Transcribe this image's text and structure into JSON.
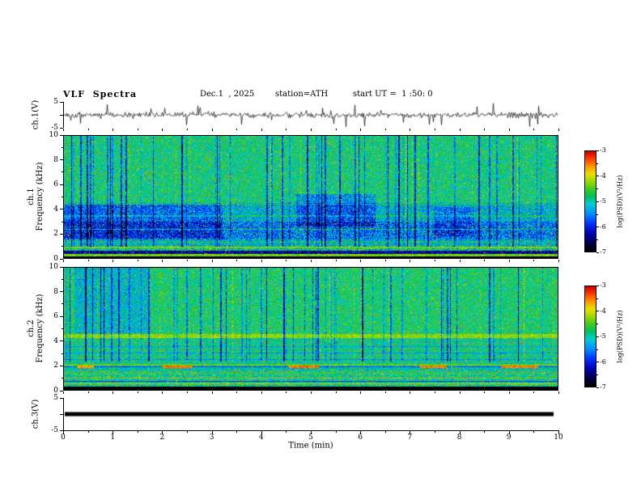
{
  "figure": {
    "title": "VLF  Spectra",
    "date": "Dec.1  , 2025",
    "station": "station=ATH",
    "start_ut": "start UT =  1 :50: 0"
  },
  "axes": {
    "time": {
      "label": "Time (min)",
      "min": 0,
      "max": 10,
      "tick_labels": [
        "0",
        "1",
        "2",
        "3",
        "4",
        "5",
        "6",
        "7",
        "8",
        "9",
        "10"
      ]
    },
    "freq": {
      "min": 0,
      "max": 10,
      "major_tick_labels": [
        "0",
        "2",
        "4",
        "6",
        "8",
        "10"
      ]
    },
    "volt": {
      "max_label": "5",
      "min_label": "-5"
    }
  },
  "panels": {
    "ch1_wave": {
      "ylabel": "ch.1(V)"
    },
    "ch1_spec": {
      "ylabel_line1": "ch.1",
      "ylabel_line2": "Frequency (kHz)"
    },
    "ch2_spec": {
      "ylabel_line1": "ch.2",
      "ylabel_line2": "Frequency (kHz)"
    },
    "ch3_wave": {
      "ylabel": "ch.3(V)"
    }
  },
  "colorbar": {
    "label": "log(PSD)(V²/Hz)",
    "tick_labels": [
      "-3",
      "-4",
      "-5",
      "-6",
      "-7"
    ],
    "zmax": -3,
    "zmin": -7
  },
  "colormap": [
    [
      -7,
      "#000000"
    ],
    [
      -6.7,
      "#000040"
    ],
    [
      -6.3,
      "#0000b0"
    ],
    [
      -5.9,
      "#0030ff"
    ],
    [
      -5.5,
      "#0090ff"
    ],
    [
      -5.1,
      "#00d0d0"
    ],
    [
      -4.8,
      "#00c060"
    ],
    [
      -4.5,
      "#40cc20"
    ],
    [
      -4.2,
      "#a0d800"
    ],
    [
      -3.9,
      "#e8e000"
    ],
    [
      -3.6,
      "#ff9800"
    ],
    [
      -3.3,
      "#ff4000"
    ],
    [
      -3,
      "#cc0000"
    ]
  ],
  "chart_data": [
    {
      "target": "wave1-canvas",
      "type": "line",
      "name": "ch.1 voltage waveform",
      "xlim": [
        0,
        10
      ],
      "ylim": [
        -5,
        5
      ],
      "xlabel": "Time (min)",
      "ylabel": "ch.1(V)",
      "seed": 1337,
      "noise_amp": 1.0,
      "spike_prob": 0.06,
      "spike_amp": 3.8,
      "description": "Continuous noisy trace centred on 0 V (~±1 V band) with frequent impulsive spikes reaching about ±5 V throughout the 10-minute record."
    },
    {
      "target": "spec1-canvas",
      "type": "heatmap",
      "name": "ch.1 spectrogram",
      "xlim": [
        0,
        10
      ],
      "ylim": [
        0,
        10
      ],
      "zlim": [
        -7,
        -3
      ],
      "xlabel": "Time (min)",
      "ylabel": "ch.1 Frequency (kHz)",
      "zlabel": "log(PSD)(V²/Hz)",
      "seed": 42,
      "bands": [
        {
          "f0": 4.5,
          "f1": 10.01,
          "level": -4.85,
          "noise": 0.55
        },
        {
          "f0": 3.0,
          "f1": 4.5,
          "level": -5.2,
          "noise": 0.6
        },
        {
          "f0": 1.5,
          "f1": 3.0,
          "level": -5.55,
          "noise": 0.7
        },
        {
          "f0": 1.0,
          "f1": 1.5,
          "level": -5.2,
          "noise": 0.6
        },
        {
          "f0": 0.6,
          "f1": 1.0,
          "level": -5.0,
          "noise": 0.9
        },
        {
          "f0": 0.3,
          "f1": 0.6,
          "level": -6.4,
          "noise": 0.7
        },
        {
          "f0": 0.13,
          "f1": 0.3,
          "level": -4.3,
          "noise": 0.4
        },
        {
          "f0": 0.0,
          "f1": 0.13,
          "level": -7,
          "noise": 0.05
        }
      ],
      "hlines": [
        {
          "f": 2.35,
          "w": 0.1,
          "level": -4.7
        },
        {
          "f": 3.45,
          "w": 0.1,
          "level": -4.8
        },
        {
          "f": 0.85,
          "w": 0.12,
          "level": -4.35
        },
        {
          "f": 1.3,
          "w": 0.1,
          "level": -4.6
        },
        {
          "f": 4.4,
          "w": 0.1,
          "level": -4.6
        }
      ],
      "patches": [
        {
          "t0": 0.0,
          "t1": 3.2,
          "f0": 1.6,
          "f1": 4.4,
          "dl": -0.45
        },
        {
          "t0": 4.7,
          "t1": 6.3,
          "f0": 2.6,
          "f1": 5.2,
          "dl": -0.55
        },
        {
          "t0": 7.5,
          "t1": 8.3,
          "f0": 1.8,
          "f1": 4.2,
          "dl": -0.4
        }
      ],
      "streak_prob": 0.13,
      "streak_min": 0.45,
      "streak_var": 1.15,
      "streak_fmin": 0.95,
      "bright_prob": 0.03,
      "speckle_prob": 0.02,
      "speckle_level": -3.6,
      "description": "Speckled green/cyan broadband background (~1e-5 V²/Hz) above ~4.5 kHz with many narrow dark-blue vertical dropout streaks; bluer suppressed band 1.5–4.5 kHz; bright narrow lines near 0.85, 1.3, 2.35, 3.45 and 4.4 kHz; dark band 0.3–0.6 kHz and black band below ~0.15 kHz; sparse orange/red speckles."
    },
    {
      "target": "spec2-canvas",
      "type": "heatmap",
      "name": "ch.2 spectrogram",
      "xlim": [
        0,
        10
      ],
      "ylim": [
        0,
        10
      ],
      "zlim": [
        -7,
        -3
      ],
      "xlabel": "Time (min)",
      "ylabel": "ch.2 Frequency (kHz)",
      "zlabel": "log(PSD)(V²/Hz)",
      "seed": 99,
      "bands": [
        {
          "f0": 4.6,
          "f1": 10.01,
          "level": -4.8,
          "noise": 0.5
        },
        {
          "f0": 4.25,
          "f1": 4.6,
          "level": -4.25,
          "noise": 0.3
        },
        {
          "f0": 2.2,
          "f1": 4.25,
          "level": -4.9,
          "noise": 0.55
        },
        {
          "f0": 1.6,
          "f1": 2.2,
          "level": -5.05,
          "noise": 0.6
        },
        {
          "f0": 0.25,
          "f1": 1.6,
          "level": -4.9,
          "noise": 0.7
        },
        {
          "f0": 0.0,
          "f1": 0.25,
          "level": -7,
          "noise": 0.05
        }
      ],
      "hlines": [
        {
          "f": 0.5,
          "w": 0.12,
          "level": -4.2
        },
        {
          "f": 0.72,
          "w": 0.07,
          "level": -5.9
        },
        {
          "f": 0.95,
          "w": 0.1,
          "level": -4.4
        },
        {
          "f": 1.35,
          "w": 0.09,
          "level": -4.5
        },
        {
          "f": 1.9,
          "w": 0.09,
          "level": -5.8
        },
        {
          "f": 2.05,
          "w": 0.09,
          "level": -4.4
        },
        {
          "f": 2.5,
          "w": 0.07,
          "level": -5.5
        },
        {
          "f": 3.0,
          "w": 0.07,
          "level": -5.45
        },
        {
          "f": 3.55,
          "w": 0.07,
          "level": -5.4
        }
      ],
      "dashes": [
        {
          "t0": 2.0,
          "t1": 2.6,
          "f0": 1.76,
          "f1": 1.98,
          "level": -3.45
        },
        {
          "t0": 4.55,
          "t1": 5.15,
          "f0": 1.76,
          "f1": 1.98,
          "level": -3.45
        },
        {
          "t0": 7.2,
          "t1": 7.75,
          "f0": 1.76,
          "f1": 1.98,
          "level": -3.5
        },
        {
          "t0": 8.85,
          "t1": 9.6,
          "f0": 1.76,
          "f1": 1.98,
          "level": -3.5
        },
        {
          "t0": 0.25,
          "t1": 0.6,
          "f0": 1.76,
          "f1": 1.98,
          "level": -3.6
        }
      ],
      "patches": [
        {
          "t0": 0.2,
          "t1": 1.7,
          "f0": 4.6,
          "f1": 10,
          "dl": -0.35
        }
      ],
      "streak_prob": 0.1,
      "streak_min": 0.45,
      "streak_var": 1.1,
      "streak_fmin": 2.3,
      "bright_prob": 0.03,
      "speckle_prob": 0.022,
      "speckle_level": -3.6,
      "description": "Green broadband background with dark-blue vertical streaks above ~2.3 kHz; bright yellow line at ~4.3 kHz; horizontally banded structure below 4 kHz with bright lines near 0.5, 0.95, 1.35 and 2.05 kHz; brown/red dashed emission segments near 1.8–2.0 kHz around t≈0.4, 2.3, 4.8, 7.5 and 9.2 min; black band below ~0.25 kHz."
    },
    {
      "target": "wave3-canvas",
      "type": "line",
      "flat": true,
      "name": "ch.3 voltage waveform",
      "xlim": [
        0,
        10
      ],
      "ylim": [
        -5,
        5
      ],
      "value": 0,
      "thickness": 5,
      "description": "Constant thick 0 V line (channel flat) for the full 10 minutes."
    }
  ]
}
